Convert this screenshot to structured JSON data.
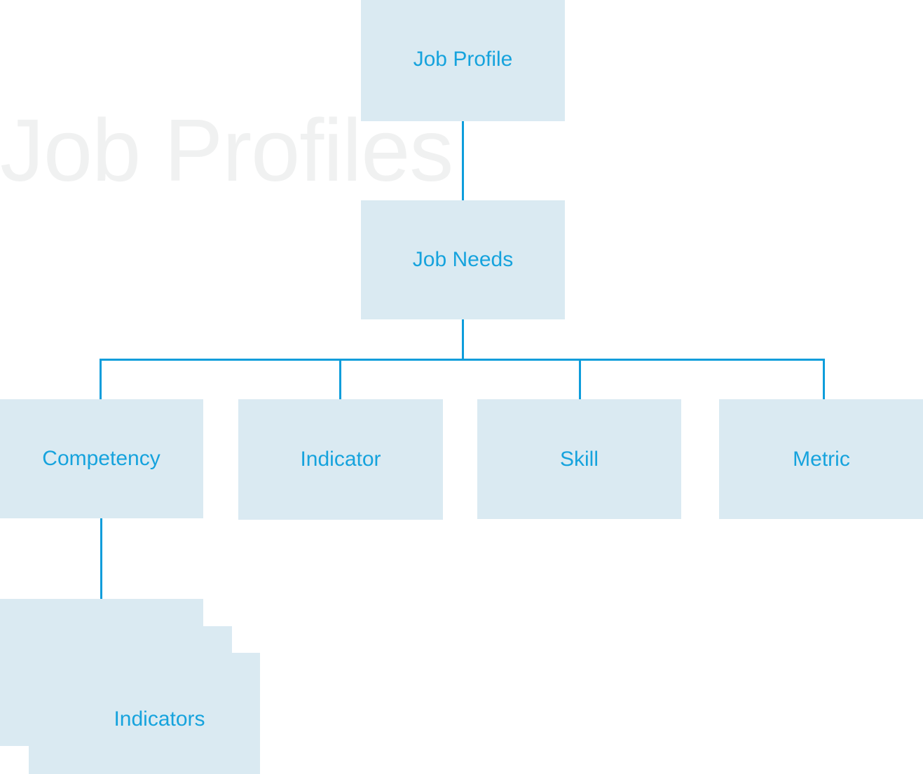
{
  "diagram": {
    "watermark": "Job Profiles",
    "colors": {
      "node_fill": "#daeaf2",
      "accent_blue": "#16a3dd",
      "connector_blue": "#0d9ddb",
      "watermark_gray": "#f0f1f1",
      "background": "#ffffff"
    },
    "nodes": {
      "root": {
        "label": "Job Profile"
      },
      "level2": {
        "label": "Job Needs"
      },
      "level3": [
        {
          "label": "Competency"
        },
        {
          "label": "Indicator"
        },
        {
          "label": "Skill"
        },
        {
          "label": "Metric"
        }
      ],
      "level4": {
        "label": "Indicators",
        "stack_count": 3
      }
    },
    "edges": [
      {
        "from": "Job Profile",
        "to": "Job Needs"
      },
      {
        "from": "Job Needs",
        "to": "Competency"
      },
      {
        "from": "Job Needs",
        "to": "Indicator"
      },
      {
        "from": "Job Needs",
        "to": "Skill"
      },
      {
        "from": "Job Needs",
        "to": "Metric"
      },
      {
        "from": "Competency",
        "to": "Indicators"
      }
    ]
  }
}
